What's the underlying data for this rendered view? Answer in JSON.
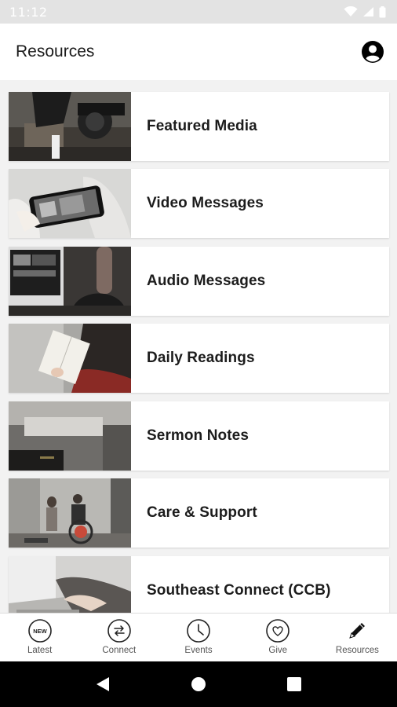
{
  "status_bar": {
    "time": "11:12"
  },
  "header": {
    "title": "Resources"
  },
  "resources": [
    {
      "label": "Featured Media"
    },
    {
      "label": "Video Messages"
    },
    {
      "label": "Audio Messages"
    },
    {
      "label": "Daily Readings"
    },
    {
      "label": "Sermon Notes"
    },
    {
      "label": "Care & Support"
    },
    {
      "label": "Southeast Connect (CCB)"
    }
  ],
  "bottom_nav": {
    "items": [
      {
        "label": "Latest",
        "icon": "new-badge-icon",
        "badge_text": "NEW"
      },
      {
        "label": "Connect",
        "icon": "swap-arrows-icon"
      },
      {
        "label": "Events",
        "icon": "clock-icon"
      },
      {
        "label": "Give",
        "icon": "heart-icon"
      },
      {
        "label": "Resources",
        "icon": "pencil-icon",
        "active": true
      }
    ]
  },
  "colors": {
    "accent": "#000000",
    "status_bar": "#e3e3e3",
    "background": "#f2f2f2"
  }
}
